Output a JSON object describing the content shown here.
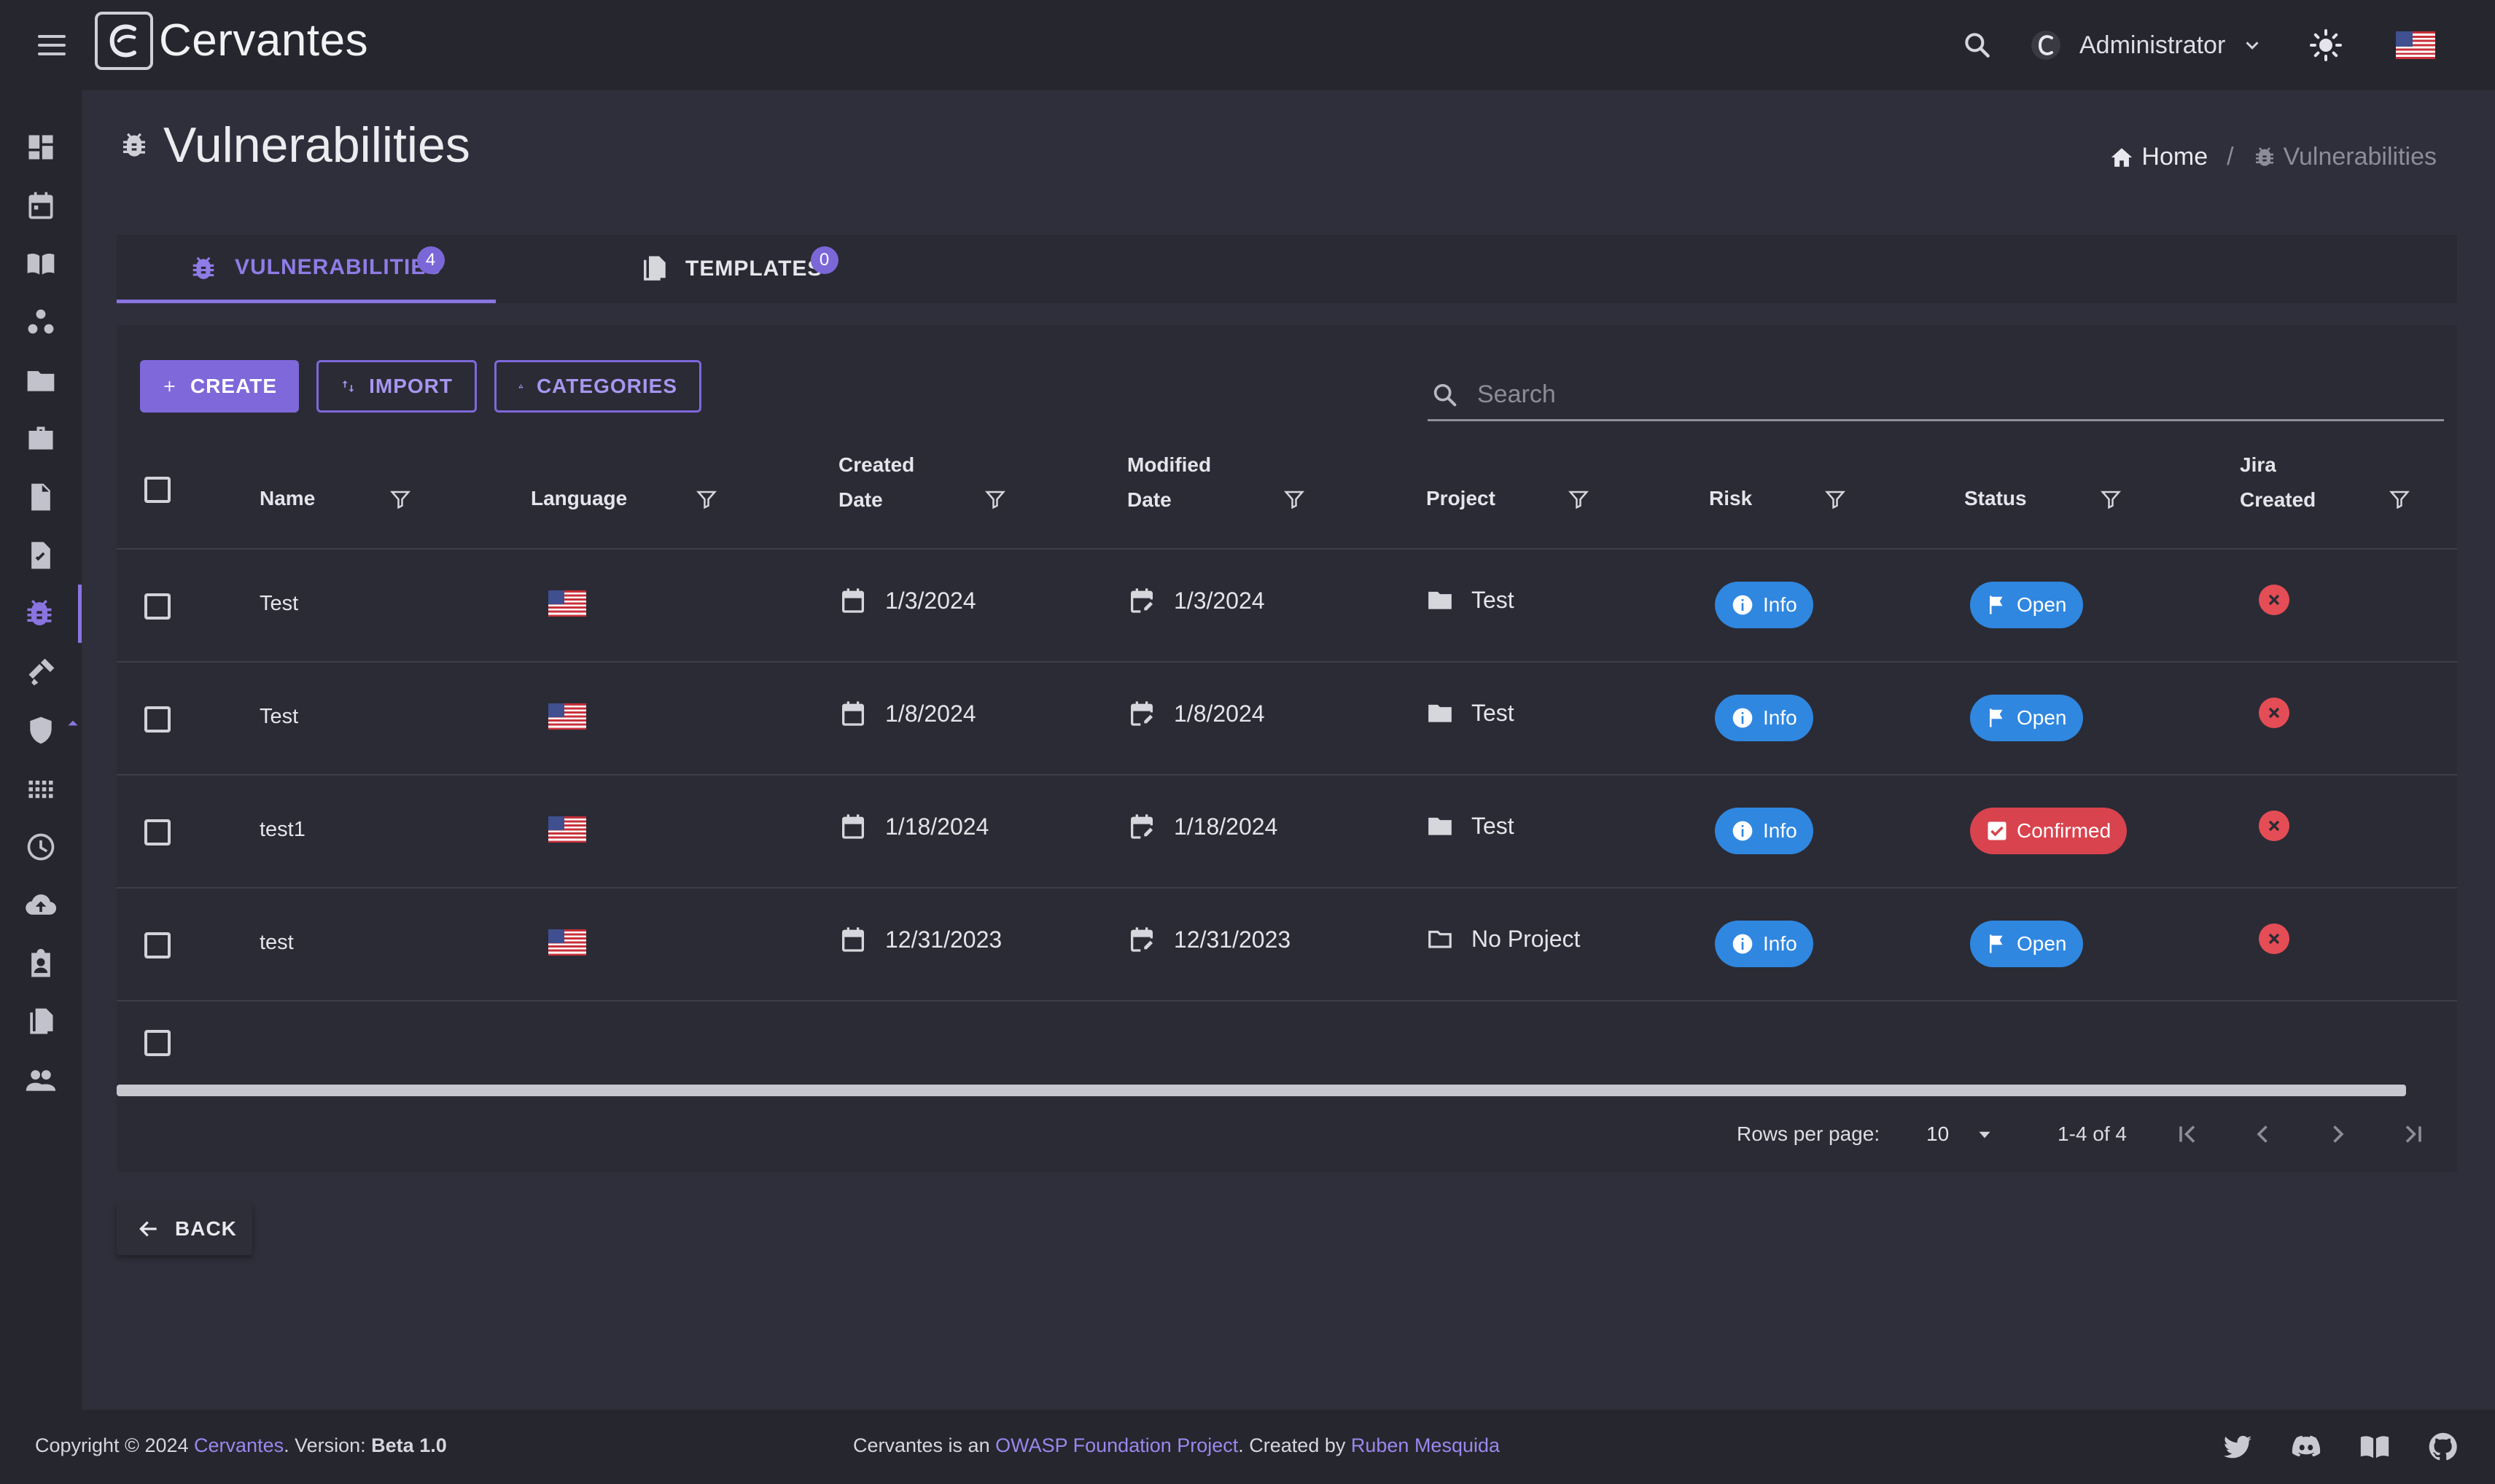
{
  "app": {
    "brand": "Cervantes"
  },
  "topbar": {
    "user_name": "Administrator"
  },
  "page": {
    "title": "Vulnerabilities"
  },
  "breadcrumb": {
    "home": "Home",
    "separator": "/",
    "current": "Vulnerabilities"
  },
  "tabs": [
    {
      "label": "VULNERABILITIES",
      "count": "4",
      "active": true
    },
    {
      "label": "TEMPLATES",
      "count": "0",
      "active": false
    }
  ],
  "toolbar": {
    "create_label": "CREATE",
    "import_label": "IMPORT",
    "categories_label": "CATEGORIES"
  },
  "search": {
    "placeholder": "Search",
    "value": ""
  },
  "table": {
    "headers": {
      "name": "Name",
      "language": "Language",
      "created_1": "Created",
      "created_2": "Date",
      "modified_1": "Modified",
      "modified_2": "Date",
      "project": "Project",
      "risk": "Risk",
      "status": "Status",
      "jira_1": "Jira",
      "jira_2": "Created"
    },
    "rows": [
      {
        "name": "Test",
        "language": "en-US",
        "created": "1/3/2024",
        "modified": "1/3/2024",
        "project": "Test",
        "risk": "Info",
        "status": "Open",
        "jira_created": false
      },
      {
        "name": "Test",
        "language": "en-US",
        "created": "1/8/2024",
        "modified": "1/8/2024",
        "project": "Test",
        "risk": "Info",
        "status": "Open",
        "jira_created": false
      },
      {
        "name": "test1",
        "language": "en-US",
        "created": "1/18/2024",
        "modified": "1/18/2024",
        "project": "Test",
        "risk": "Info",
        "status": "Confirmed",
        "jira_created": false
      },
      {
        "name": "test",
        "language": "en-US",
        "created": "12/31/2023",
        "modified": "12/31/2023",
        "project": "No Project",
        "risk": "Info",
        "status": "Open",
        "jira_created": false
      }
    ]
  },
  "pagination": {
    "rows_label": "Rows per page:",
    "rows_value": "10",
    "range": "1-4 of 4"
  },
  "back_label": "BACK",
  "footer": {
    "copyright": "Copyright © 2024",
    "brand_link": "Cervantes",
    "version_label": ". Version:",
    "version": "Beta 1.0",
    "project_text_1": "Cervantes is an",
    "owasp_link": "OWASP Foundation Project",
    "project_text_2": ". Created by",
    "author_link": "Ruben Mesquida"
  },
  "colors": {
    "accent": "#7e68da",
    "info": "#2f87e0",
    "confirmed": "#d9434e",
    "error": "#e44d55"
  },
  "icons": {
    "sidebar": [
      "dashboard-icon",
      "calendar-icon",
      "book-icon",
      "organization-icon",
      "folder-icon",
      "briefcase-icon",
      "document-icon",
      "task-icon",
      "bug-icon",
      "hammer-icon",
      "shield-icon",
      "apps-icon",
      "clock-icon",
      "cloud-upload-icon",
      "badge-icon",
      "copy-icon",
      "people-icon"
    ],
    "footer": [
      "twitter-icon",
      "discord-icon",
      "book-icon",
      "github-icon"
    ]
  }
}
